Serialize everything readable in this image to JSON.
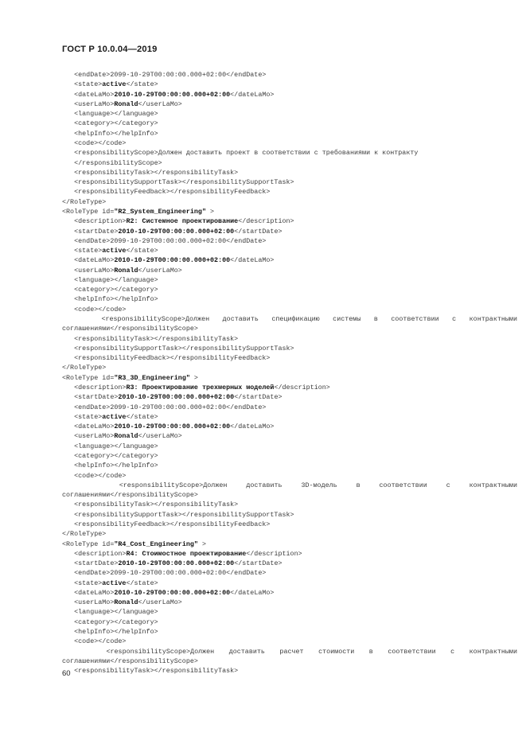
{
  "document": {
    "standard_header": "ГОСТ Р 10.0.04—2019",
    "page_number": "60"
  },
  "code": {
    "lines": [
      {
        "id": "l01",
        "indent": 1,
        "text": "<endDate>2099-10-29T00:00:00.000+02:00</endDate>"
      },
      {
        "id": "l02",
        "indent": 1,
        "pre": "<state>",
        "bold": "active",
        "post": "</state>"
      },
      {
        "id": "l03",
        "indent": 1,
        "pre": "<dateLaMo>",
        "bold": "2010-10-29T00:00:00.000+02:00",
        "post": "</dateLaMo>"
      },
      {
        "id": "l04",
        "indent": 1,
        "pre": "<userLaMo>",
        "bold": "Ronald",
        "post": "</userLaMo>"
      },
      {
        "id": "l05",
        "indent": 1,
        "text": "<language></language>"
      },
      {
        "id": "l06",
        "indent": 1,
        "text": "<category></category>"
      },
      {
        "id": "l07",
        "indent": 1,
        "text": "<helpInfo></helpInfo>"
      },
      {
        "id": "l08",
        "indent": 1,
        "text": "<code></code>"
      },
      {
        "id": "l09",
        "indent": 1,
        "wrap": true,
        "justify": true,
        "text": "<responsibilityScope>Должен доставить проект в соответствии с требованиями к контракту"
      },
      {
        "id": "l10",
        "indent": 1,
        "text": "</responsibilityScope>"
      },
      {
        "id": "l11",
        "indent": 1,
        "text": "<responsibilityTask></responsibilityTask>"
      },
      {
        "id": "l12",
        "indent": 1,
        "text": "<responsibilitySupportTask></responsibilitySupportTask>"
      },
      {
        "id": "l13",
        "indent": 1,
        "text": "<responsibilityFeedback></responsibilityFeedback>"
      },
      {
        "id": "l14",
        "indent": 0,
        "text": "</RoleType>"
      },
      {
        "id": "l15",
        "indent": 0,
        "pre": "<RoleType id=",
        "bold": "\"R2_System_Engineering\"",
        "post": " >"
      },
      {
        "id": "l16",
        "indent": 1,
        "pre": "<description>",
        "bold": "R2: Системное проектирование",
        "post": "</description>"
      },
      {
        "id": "l17",
        "indent": 1,
        "pre": "<startDate>",
        "bold": "2010-10-29T00:00:00.000+02:00",
        "post": "</startDate>"
      },
      {
        "id": "l18",
        "indent": 1,
        "text": "<endDate>2099-10-29T00:00:00.000+02:00</endDate>"
      },
      {
        "id": "l19",
        "indent": 1,
        "pre": "<state>",
        "bold": "active",
        "post": "</state>"
      },
      {
        "id": "l20",
        "indent": 1,
        "pre": "<dateLaMo>",
        "bold": "2010-10-29T00:00:00.000+02:00",
        "post": "</dateLaMo>"
      },
      {
        "id": "l21",
        "indent": 1,
        "pre": "<userLaMo>",
        "bold": "Ronald",
        "post": "</userLaMo>"
      },
      {
        "id": "l22",
        "indent": 1,
        "text": "<language></language>"
      },
      {
        "id": "l23",
        "indent": 1,
        "text": "<category></category>"
      },
      {
        "id": "l24",
        "indent": 1,
        "text": "<helpInfo></helpInfo>"
      },
      {
        "id": "l25",
        "indent": 1,
        "text": "<code></code>"
      },
      {
        "id": "l26",
        "indent": 1,
        "wrap": true,
        "justify": true,
        "text": "<responsibilityScope>Должен доставить спецификацию системы в соответствии с контрактными соглашениями</responsibilityScope>"
      },
      {
        "id": "l27",
        "indent": 1,
        "text": "<responsibilityTask></responsibilityTask>"
      },
      {
        "id": "l28",
        "indent": 1,
        "text": "<responsibilitySupportTask></responsibilitySupportTask>"
      },
      {
        "id": "l29",
        "indent": 1,
        "text": "<responsibilityFeedback></responsibilityFeedback>"
      },
      {
        "id": "l30",
        "indent": 0,
        "text": "</RoleType>"
      },
      {
        "id": "l31",
        "indent": 0,
        "pre": "<RoleType id=",
        "bold": "\"R3_3D_Engineering\"",
        "post": " >"
      },
      {
        "id": "l32",
        "indent": 1,
        "pre": "<description>",
        "bold": "R3: Проектирование трехмерных моделей",
        "post": "</description>"
      },
      {
        "id": "l33",
        "indent": 1,
        "pre": "<startDate>",
        "bold": "2010-10-29T00:00:00.000+02:00",
        "post": "</startDate>"
      },
      {
        "id": "l34",
        "indent": 1,
        "text": "<endDate>2099-10-29T00:00:00.000+02:00</endDate>"
      },
      {
        "id": "l35",
        "indent": 1,
        "pre": "<state>",
        "bold": "active",
        "post": "</state>"
      },
      {
        "id": "l36",
        "indent": 1,
        "pre": "<dateLaMo>",
        "bold": "2010-10-29T00:00:00.000+02:00",
        "post": "</dateLaMo>"
      },
      {
        "id": "l37",
        "indent": 1,
        "pre": "<userLaMo>",
        "bold": "Ronald",
        "post": "</userLaMo>"
      },
      {
        "id": "l38",
        "indent": 1,
        "text": "<language></language>"
      },
      {
        "id": "l39",
        "indent": 1,
        "text": "<category></category>"
      },
      {
        "id": "l40",
        "indent": 1,
        "text": "<helpInfo></helpInfo>"
      },
      {
        "id": "l41",
        "indent": 1,
        "text": "<code></code>"
      },
      {
        "id": "l42",
        "indent": 1,
        "wrap": true,
        "justify": true,
        "text": "<responsibilityScope>Должен доставить 3D-модель в соответствии с контрактными соглашениями</responsibilityScope>"
      },
      {
        "id": "l43",
        "indent": 1,
        "text": "<responsibilityTask></responsibilityTask>"
      },
      {
        "id": "l44",
        "indent": 1,
        "text": "<responsibilitySupportTask></responsibilitySupportTask>"
      },
      {
        "id": "l45",
        "indent": 1,
        "text": "<responsibilityFeedback></responsibilityFeedback>"
      },
      {
        "id": "l46",
        "indent": 0,
        "text": "</RoleType>"
      },
      {
        "id": "l47",
        "indent": 0,
        "pre": "<RoleType id=",
        "bold": "\"R4_Cost_Engineering\"",
        "post": " >"
      },
      {
        "id": "l48",
        "indent": 1,
        "pre": "<description>",
        "bold": "R4: Стоимостное проектирование",
        "post": "</description>"
      },
      {
        "id": "l49",
        "indent": 1,
        "pre": "<startDate>",
        "bold": "2010-10-29T00:00:00.000+02:00",
        "post": "</startDate>"
      },
      {
        "id": "l50",
        "indent": 1,
        "text": "<endDate>2099-10-29T00:00:00.000+02:00</endDate>"
      },
      {
        "id": "l51",
        "indent": 1,
        "pre": "<state>",
        "bold": "active",
        "post": "</state>"
      },
      {
        "id": "l52",
        "indent": 1,
        "pre": "<dateLaMo>",
        "bold": "2010-10-29T00:00:00.000+02:00",
        "post": "</dateLaMo>"
      },
      {
        "id": "l53",
        "indent": 1,
        "pre": "<userLaMo>",
        "bold": "Ronald",
        "post": "</userLaMo>"
      },
      {
        "id": "l54",
        "indent": 1,
        "text": "<language></language>"
      },
      {
        "id": "l55",
        "indent": 1,
        "text": "<category></category>"
      },
      {
        "id": "l56",
        "indent": 1,
        "text": "<helpInfo></helpInfo>"
      },
      {
        "id": "l57",
        "indent": 1,
        "text": "<code></code>"
      },
      {
        "id": "l58",
        "indent": 1,
        "wrap": true,
        "justify": true,
        "text": "<responsibilityScope>Должен доставить расчет стоимости в соответствии с контрактными соглашениями</responsibilityScope>"
      },
      {
        "id": "l59",
        "indent": 1,
        "text": "<responsibilityTask></responsibilityTask>"
      }
    ]
  }
}
